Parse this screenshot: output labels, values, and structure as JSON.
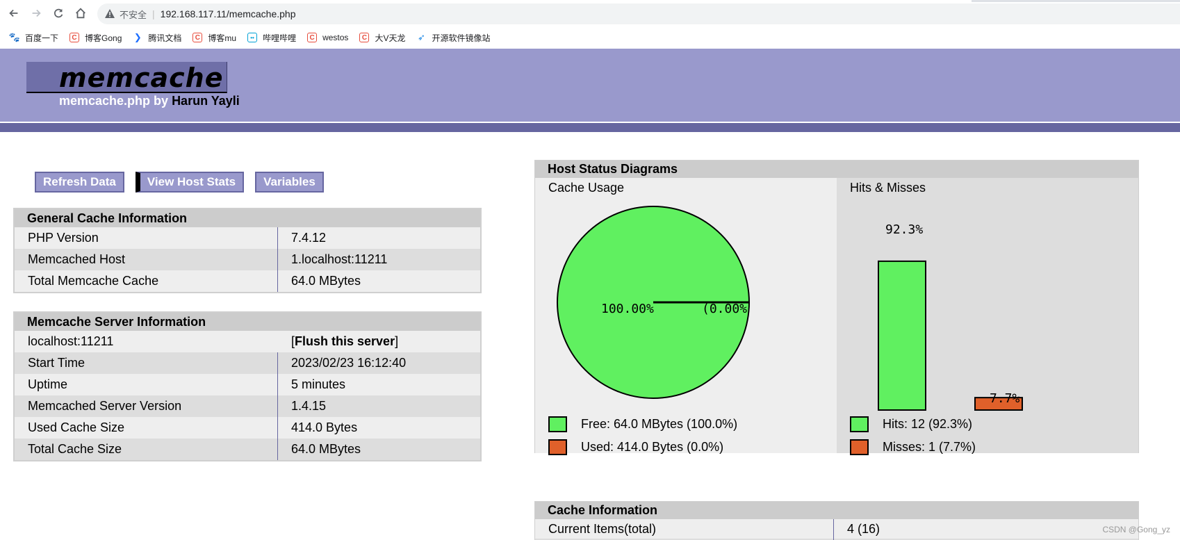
{
  "browser": {
    "insecure_label": "不安全",
    "url": "192.168.117.11/memcache.php",
    "bookmarks": [
      {
        "label": "百度一下",
        "icon": "baidu-paw-icon"
      },
      {
        "label": "博客Gong",
        "icon": "csdn-icon"
      },
      {
        "label": "腾讯文档",
        "icon": "tencent-docs-icon"
      },
      {
        "label": "博客mu",
        "icon": "csdn-icon"
      },
      {
        "label": "哔哩哔哩",
        "icon": "bilibili-icon"
      },
      {
        "label": "westos",
        "icon": "csdn-icon"
      },
      {
        "label": "大V天龙",
        "icon": "csdn-icon"
      },
      {
        "label": "开源软件镜像站",
        "icon": "mirror-icon"
      }
    ]
  },
  "header": {
    "logo": "memcache",
    "sub_prefix": "memcache.php by ",
    "author": "Harun Yayli"
  },
  "menu": {
    "refresh": "Refresh Data",
    "host_stats": "View Host Stats",
    "variables": "Variables"
  },
  "general": {
    "title": "General Cache Information",
    "rows": [
      {
        "k": "PHP Version",
        "v": "7.4.12"
      },
      {
        "k": "Memcached Host",
        "v": "1.localhost:11211"
      },
      {
        "k": "Total Memcache Cache",
        "v": "64.0 MBytes"
      }
    ]
  },
  "server": {
    "title": "Memcache Server Information",
    "host": "localhost:11211",
    "flush_open": "[",
    "flush_label": "Flush this server",
    "flush_close": "]",
    "rows": [
      {
        "k": "Start Time",
        "v": "2023/02/23 16:12:40"
      },
      {
        "k": "Uptime",
        "v": "5 minutes"
      },
      {
        "k": "Memcached Server Version",
        "v": "1.4.15"
      },
      {
        "k": "Used Cache Size",
        "v": "414.0 Bytes"
      },
      {
        "k": "Total Cache Size",
        "v": "64.0 MBytes"
      }
    ]
  },
  "diagrams": {
    "title": "Host Status Diagrams",
    "cache_usage_title": "Cache Usage",
    "hits_misses_title": "Hits & Misses",
    "pie_free_label": "100.00%",
    "pie_used_label": "(0.00%",
    "free_legend": "Free: 64.0 MBytes (100.0%)",
    "used_legend": "Used: 414.0 Bytes (0.0%)",
    "hits_legend": "Hits: 12 (92.3%)",
    "misses_legend": "Misses: 1 (7.7%)",
    "hits_bar_label": "92.3%",
    "misses_bar_label": "7.7%",
    "colors": {
      "green": "#60f060",
      "orange": "#e0602a"
    }
  },
  "chart_data": [
    {
      "type": "pie",
      "title": "Cache Usage",
      "categories": [
        "Free",
        "Used"
      ],
      "values": [
        100.0,
        0.0
      ]
    },
    {
      "type": "bar",
      "title": "Hits & Misses",
      "categories": [
        "Hits",
        "Misses"
      ],
      "values": [
        92.3,
        7.7
      ]
    }
  ],
  "cache_info": {
    "title": "Cache Information",
    "rows": [
      {
        "k": "Current Items(total)",
        "v": "4 (16)"
      }
    ]
  },
  "watermark": "CSDN @Gong_yz"
}
